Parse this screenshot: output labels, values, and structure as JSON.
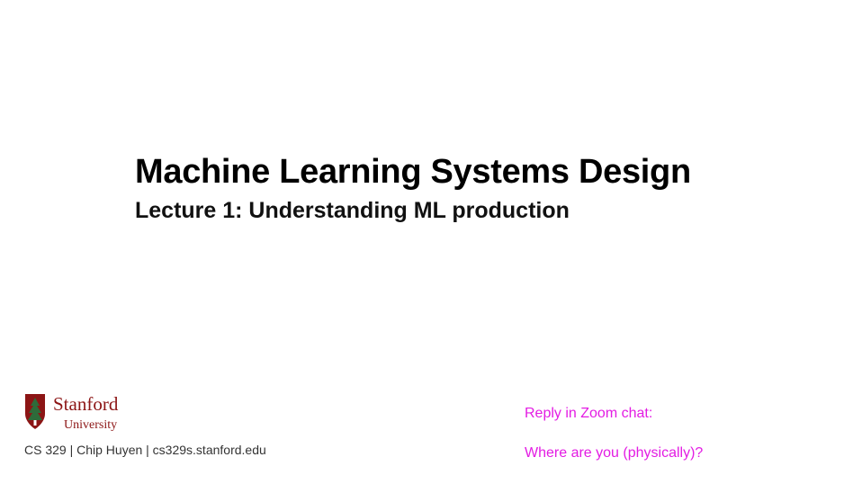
{
  "slide": {
    "title": "Machine Learning Systems Design",
    "subtitle": "Lecture 1: Understanding ML production",
    "logo": {
      "icon": "stanford-tree-seal-icon",
      "line1": "Stanford",
      "line2": "University",
      "color": "#8c1515"
    },
    "footer": "CS 329 | Chip Huyen | cs329s.stanford.edu",
    "chat_prompt": "Reply in Zoom chat:",
    "chat_question": "Where are you (physically)?",
    "accent_color": "#e31ce3"
  }
}
